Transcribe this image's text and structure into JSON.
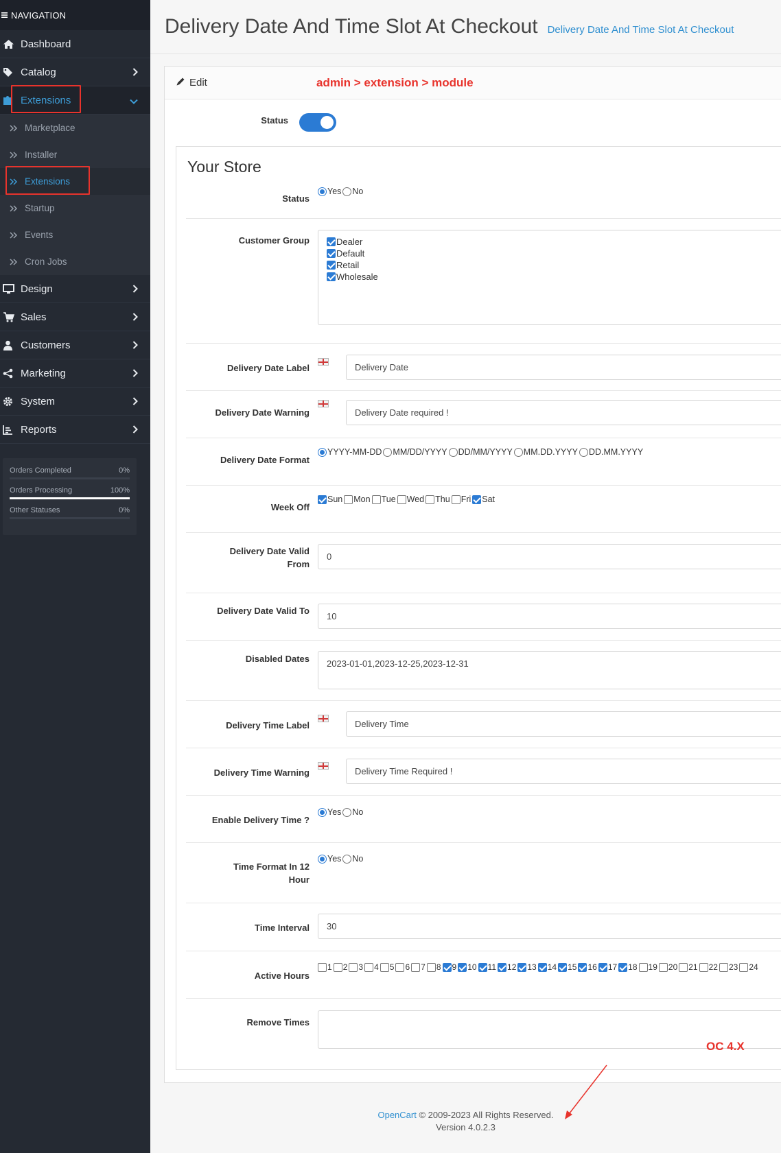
{
  "sidebar": {
    "header": "NAVIGATION",
    "items": [
      {
        "label": "Dashboard",
        "icon": "home-icon"
      },
      {
        "label": "Catalog",
        "icon": "tag-icon"
      },
      {
        "label": "Extensions",
        "icon": "puzzle-icon"
      },
      {
        "label": "Design",
        "icon": "monitor-icon"
      },
      {
        "label": "Sales",
        "icon": "cart-icon"
      },
      {
        "label": "Customers",
        "icon": "user-icon"
      },
      {
        "label": "Marketing",
        "icon": "share-icon"
      },
      {
        "label": "System",
        "icon": "gear-icon"
      },
      {
        "label": "Reports",
        "icon": "bar-chart-icon"
      }
    ],
    "extensions_sub": [
      "Marketplace",
      "Installer",
      "Extensions",
      "Startup",
      "Events",
      "Cron Jobs"
    ],
    "stats": [
      {
        "label": "Orders Completed",
        "value": "0%",
        "fill": 0
      },
      {
        "label": "Orders Processing",
        "value": "100%",
        "fill": 1
      },
      {
        "label": "Other Statuses",
        "value": "0%",
        "fill": 0
      }
    ]
  },
  "page": {
    "title": "Delivery Date And Time Slot At Checkout",
    "breadcrumb": "Delivery Date And Time Slot At Checkout",
    "panel_heading": "Edit",
    "annotation_path": "admin > extension > module",
    "annotation_version": "OC 4.X"
  },
  "form": {
    "status_label": "Status",
    "store_title": "Your Store",
    "store_status_label": "Status",
    "yes": "Yes",
    "no": "No",
    "customer_group_label": "Customer Group",
    "customer_groups": [
      "Dealer",
      "Default",
      "Retail",
      "Wholesale"
    ],
    "delivery_date_label_label": "Delivery Date Label",
    "delivery_date_label_value": "Delivery Date",
    "delivery_date_warning_label": "Delivery Date Warning",
    "delivery_date_warning_value": "Delivery Date required !",
    "delivery_date_format_label": "Delivery Date Format",
    "date_formats": [
      "YYYY-MM-DD",
      "MM/DD/YYYY",
      "DD/MM/YYYY",
      "MM.DD.YYYY",
      "DD.MM.YYYY"
    ],
    "week_off_label": "Week Off",
    "days": [
      "Sun",
      "Mon",
      "Tue",
      "Wed",
      "Thu",
      "Fri",
      "Sat"
    ],
    "days_checked": [
      true,
      false,
      false,
      false,
      false,
      false,
      true
    ],
    "valid_from_label_1": "Delivery Date Valid",
    "valid_from_label_2": "From",
    "valid_from_value": "0",
    "valid_to_label": "Delivery Date Valid To",
    "valid_to_value": "10",
    "disabled_dates_label": "Disabled Dates",
    "disabled_dates_value": "2023-01-01,2023-12-25,2023-12-31",
    "delivery_time_label_label": "Delivery Time Label",
    "delivery_time_label_value": "Delivery Time",
    "delivery_time_warning_label": "Delivery Time Warning",
    "delivery_time_warning_value": "Delivery Time Required !",
    "enable_time_label": "Enable Delivery Time ?",
    "time_format_label_1": "Time Format In 12",
    "time_format_label_2": "Hour",
    "time_interval_label": "Time Interval",
    "time_interval_value": "30",
    "active_hours_label": "Active Hours",
    "hours_checked": [
      false,
      false,
      false,
      false,
      false,
      false,
      false,
      false,
      true,
      true,
      true,
      true,
      true,
      true,
      true,
      true,
      true,
      true,
      false,
      false,
      false,
      false,
      false,
      false
    ],
    "remove_times_label": "Remove Times"
  },
  "footer": {
    "brand": "OpenCart",
    "copyright": "© 2009-2023 All Rights Reserved.",
    "version": "Version 4.0.2.3"
  },
  "colors": {
    "sidebar_bg": "#252a33",
    "accent": "#2b7bd4",
    "annotation_red": "#e8332c"
  }
}
